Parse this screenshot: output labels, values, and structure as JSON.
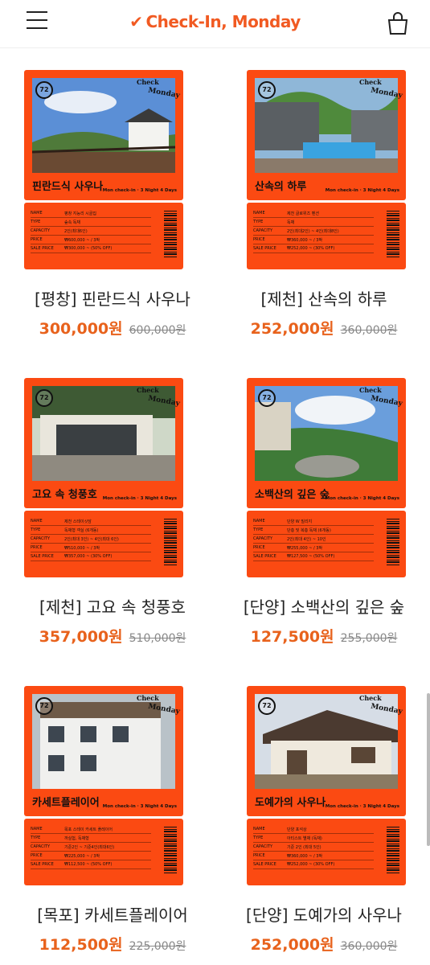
{
  "header": {
    "logo": "Check-In, Monday",
    "menu_icon": "hamburger-menu-icon",
    "cart_icon": "shopping-bag-icon"
  },
  "colors": {
    "brand": "#f15a22",
    "ticket": "#fb4a12",
    "price": "#e8621c"
  },
  "ticket_common": {
    "badge": "72",
    "stamp_line1": "Check",
    "stamp_line2": "Monday",
    "subtitle": "Mon check-in · 3 Night 4 Days",
    "labels": [
      "NAME",
      "TYPE",
      "CAPACITY",
      "PRICE",
      "SALE PRICE"
    ]
  },
  "products": [
    {
      "ticket_name": "핀란드식 사우나",
      "info": [
        "평창 지능리 시골집",
        "숲속 독채",
        "2인(최대6인)",
        "₩600,000 ~ / 3박",
        "₩300,000 ~ (50% OFF)"
      ],
      "title": "[평창] 핀란드식 사우나",
      "price": "300,000원",
      "original_price": "600,000원"
    },
    {
      "ticket_name": "산속의 하루",
      "info": [
        "제천 글로위즈 펜션",
        "독채",
        "2인(최대2인) ~ 4인(최대8인)",
        "₩360,000 ~ / 3박",
        "₩252,000 ~ (30% OFF)"
      ],
      "title": "[제천] 산속의 하루",
      "price": "252,000원",
      "original_price": "360,000원"
    },
    {
      "ticket_name": "고요 속 청풍호",
      "info": [
        "제천 스테이싯담",
        "독채형 객실 (6개동)",
        "2인(최대 3인) ~ 4인(최대 6인)",
        "₩510,000 ~ / 3박",
        "₩357,000 ~ (30% OFF)"
      ],
      "title": "[제천] 고요 속 청풍호",
      "price": "357,000원",
      "original_price": "510,000원"
    },
    {
      "ticket_name": "소백산의 깊은 숲",
      "info": [
        "단양 W 빌리지",
        "단층 및 복층 독채 (6개동)",
        "2인(최대 4인) ~ 10인",
        "₩255,000 ~ / 3박",
        "₩127,500 ~ (50% OFF)"
      ],
      "title": "[단양] 소백산의 깊은 숲",
      "price": "127,500원",
      "original_price": "255,000원"
    },
    {
      "ticket_name": "카세트플레이어",
      "info": [
        "목포 스테이 카세트 플레이어",
        "까실험, 독채형",
        "기준2인 ~ 기준4인(최대6인)",
        "₩225,000 ~ / 3박",
        "₩112,500 ~ (50% OFF)"
      ],
      "title": "[목포] 카세트플레이어",
      "price": "112,500원",
      "original_price": "225,000원"
    },
    {
      "ticket_name": "도예가의 사우나",
      "info": [
        "단양 포석상",
        "아티스트 별채 (독채)",
        "기준 2인 (최대 5인)",
        "₩360,000 ~ / 3박",
        "₩252,000 ~ (30% OFF)"
      ],
      "title": "[단양] 도예가의 사우나",
      "price": "252,000원",
      "original_price": "360,000원"
    }
  ]
}
